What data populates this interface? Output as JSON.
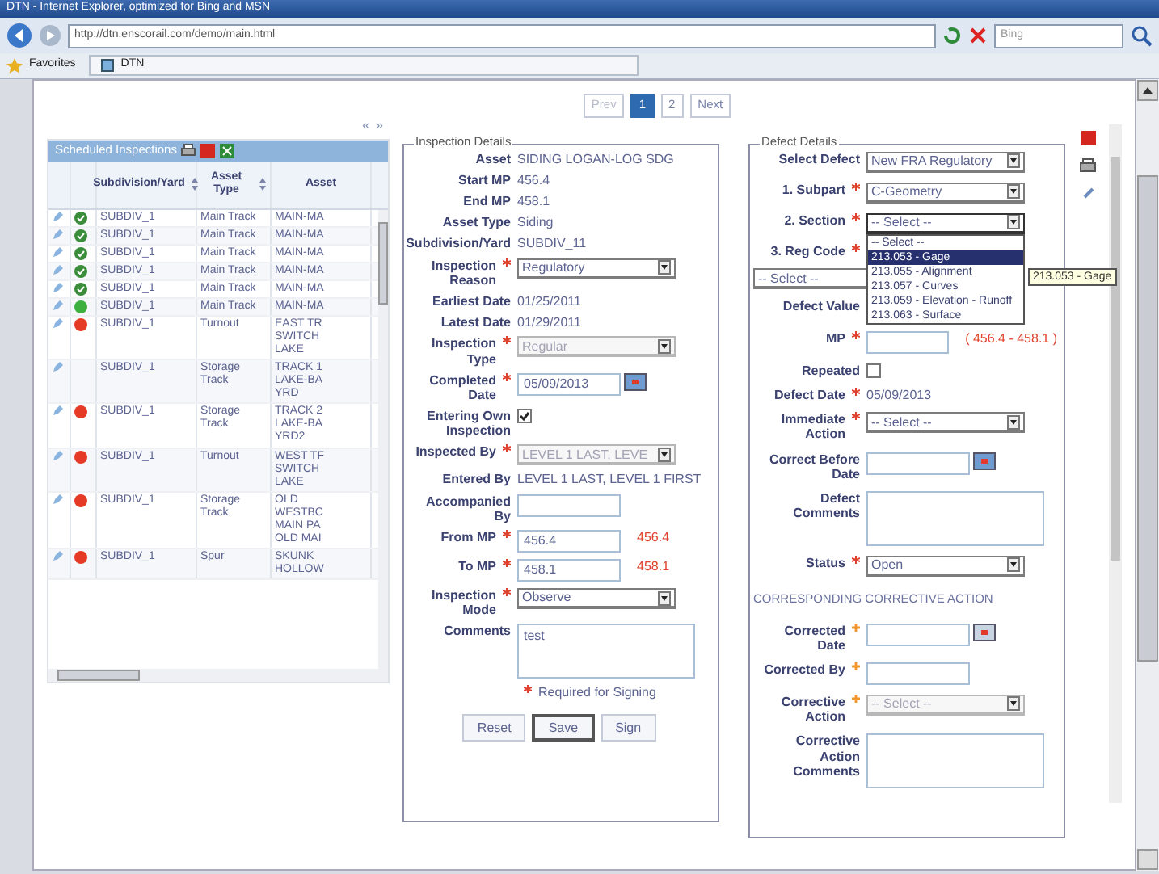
{
  "browser": {
    "title": "DTN - Internet Explorer, optimized for Bing and MSN",
    "address": "http://dtn.enscorail.com/demo/main.html",
    "search_placeholder": "Bing",
    "favorites": "Favorites",
    "tab": "DTN"
  },
  "pagination": [
    {
      "label": "Prev",
      "selected": false,
      "disabled": true
    },
    {
      "label": "1",
      "selected": true,
      "disabled": false
    },
    {
      "label": "2",
      "selected": false,
      "disabled": false
    },
    {
      "label": "Next",
      "selected": false,
      "disabled": false
    }
  ],
  "collapse": [
    "«",
    "»"
  ],
  "scheduled": {
    "title": "Scheduled Inspections",
    "columns": [
      {
        "label": "Subdivision/Yard",
        "sortable": true
      },
      {
        "label": "Asset Type",
        "sortable": true
      },
      {
        "label": "Asset",
        "sortable": false
      }
    ],
    "rows": [
      {
        "kind": "done",
        "subdivision": "SUBDIV_1",
        "asset_type": "Main Track",
        "asset": [
          "MAIN-MA"
        ]
      },
      {
        "kind": "done",
        "subdivision": "SUBDIV_1",
        "asset_type": "Main Track",
        "asset": [
          "MAIN-MA"
        ]
      },
      {
        "kind": "done",
        "subdivision": "SUBDIV_1",
        "asset_type": "Main Track",
        "asset": [
          "MAIN-MA"
        ]
      },
      {
        "kind": "done",
        "subdivision": "SUBDIV_1",
        "asset_type": "Main Track",
        "asset": [
          "MAIN-MA"
        ]
      },
      {
        "kind": "done",
        "subdivision": "SUBDIV_1",
        "asset_type": "Main Track",
        "asset": [
          "MAIN-MA"
        ]
      },
      {
        "kind": "ok",
        "subdivision": "SUBDIV_1",
        "asset_type": "Main Track",
        "asset": [
          "MAIN-MA"
        ]
      },
      {
        "kind": "overdue",
        "subdivision": "SUBDIV_1",
        "asset_type": "Turnout",
        "asset": [
          "EAST TR",
          "SWITCH",
          "LAKE"
        ]
      },
      {
        "subdivision": "SUBDIV_1",
        "asset_type": "Storage Track",
        "asset": [
          "TRACK 1",
          "LAKE-BA",
          "YRD"
        ]
      },
      {
        "kind": "overdue",
        "subdivision": "SUBDIV_1",
        "asset_type": "Storage Track",
        "asset": [
          "TRACK 2",
          "LAKE-BA",
          "YRD2"
        ]
      },
      {
        "kind": "overdue",
        "subdivision": "SUBDIV_1",
        "asset_type": "Turnout",
        "asset": [
          "WEST TF",
          "SWITCH",
          "LAKE"
        ]
      },
      {
        "kind": "overdue",
        "subdivision": "SUBDIV_1",
        "asset_type": "Storage Track",
        "asset": [
          "OLD",
          "WESTBC",
          "MAIN PA",
          "OLD MAI"
        ]
      },
      {
        "kind": "overdue",
        "subdivision": "SUBDIV_1",
        "asset_type": "Spur",
        "asset": [
          "SKUNK",
          "HOLLOW"
        ]
      }
    ]
  },
  "inspection": {
    "legend": "Inspection Details",
    "fields": [
      {
        "kind": "text",
        "label": "Asset",
        "value": "SIDING LOGAN-LOG SDG"
      },
      {
        "kind": "text",
        "label": "Start MP",
        "value": "456.4"
      },
      {
        "kind": "text",
        "label": "End MP",
        "value": "458.1"
      },
      {
        "kind": "text",
        "label": "Asset Type",
        "value": "Siding"
      },
      {
        "kind": "text",
        "label": "Subdivision/Yard",
        "value": "SUBDIV_11"
      },
      {
        "kind": "select",
        "label": "Inspection Reason",
        "required": true,
        "value": "Regulatory",
        "disabled": false
      },
      {
        "kind": "text",
        "label": "Earliest Date",
        "value": "01/25/2011"
      },
      {
        "kind": "text",
        "label": "Latest Date",
        "value": "01/29/2011"
      },
      {
        "kind": "select",
        "label": "Inspection Type",
        "required": true,
        "value": "Regular",
        "disabled": true
      },
      {
        "kind": "date",
        "label": "Completed Date",
        "required": true,
        "value": "05/09/2013",
        "disabled": false
      },
      {
        "kind": "checkbox",
        "label": "Entering Own Inspection",
        "checked": true
      },
      {
        "kind": "select",
        "label": "Inspected By",
        "required": true,
        "value": "LEVEL 1 LAST, LEVE",
        "disabled": true
      },
      {
        "kind": "text",
        "label": "Entered By",
        "value": "LEVEL 1 LAST, LEVEL 1 FIRST"
      },
      {
        "kind": "input",
        "label": "Accompanied By"
      },
      {
        "kind": "input",
        "label": "From MP",
        "required": true,
        "value": "456.4",
        "note": "456.4"
      },
      {
        "kind": "input",
        "label": "To MP",
        "required": true,
        "value": "458.1",
        "note": "458.1"
      },
      {
        "kind": "select",
        "label": "Inspection Mode",
        "required": true,
        "value": "Observe",
        "disabled": false
      },
      {
        "kind": "textarea",
        "label": "Comments",
        "value": "test"
      }
    ],
    "required_note": "Required for Signing",
    "buttons": [
      {
        "label": "Reset",
        "selected": false
      },
      {
        "label": "Save",
        "selected": true
      },
      {
        "label": "Sign",
        "selected": false
      }
    ]
  },
  "defect": {
    "legend": "Defect Details",
    "fields": [
      {
        "kind": "select",
        "label": "Select Defect",
        "value": "New FRA Regulatory",
        "disabled": false
      },
      {
        "kind": "select",
        "label": "1. Subpart",
        "required": true,
        "value": "C-Geometry",
        "disabled": false
      },
      {
        "kind": "select",
        "label": "2. Section",
        "required": true,
        "value": "-- Select --",
        "disabled": false,
        "open": true
      },
      {
        "kind": "label",
        "label": "3. Reg Code",
        "required": true
      },
      {
        "kind": "wideselect",
        "value": "-- Select --"
      },
      {
        "kind": "input",
        "label": "Defect Value"
      },
      {
        "kind": "input",
        "label": "MP",
        "required": true,
        "note": "( 456.4 - 458.1 )"
      },
      {
        "kind": "checkbox",
        "label": "Repeated",
        "checked": false
      },
      {
        "kind": "text",
        "label": "Defect Date",
        "required": true,
        "value": "05/09/2013"
      },
      {
        "kind": "select",
        "label": "Immediate Action",
        "required": true,
        "value": "-- Select --",
        "disabled": false
      },
      {
        "kind": "date",
        "label": "Correct Before Date",
        "disabled": false
      },
      {
        "kind": "textarea",
        "label": "Defect Comments"
      },
      {
        "kind": "select",
        "label": "Status",
        "required": true,
        "value": "Open",
        "disabled": false
      },
      {
        "kind": "heading",
        "label": "CORRESPONDING CORRECTIVE ACTION"
      },
      {
        "kind": "date",
        "label": "Corrected Date",
        "conditional": true,
        "disabled": true
      },
      {
        "kind": "input",
        "label": "Corrected By",
        "conditional": true
      },
      {
        "kind": "select",
        "label": "Corrective Action",
        "conditional": true,
        "value": "-- Select --",
        "disabled": true
      },
      {
        "kind": "textarea",
        "label": "Corrective Action Comments"
      }
    ],
    "dropdown": [
      {
        "label": "-- Select --",
        "selected": false
      },
      {
        "label": "213.053 - Gage",
        "selected": true
      },
      {
        "label": "213.055 - Alignment",
        "selected": false
      },
      {
        "label": "213.057 - Curves",
        "selected": false
      },
      {
        "label": "213.059 - Elevation - Runoff",
        "selected": false
      },
      {
        "label": "213.063 - Surface",
        "selected": false
      }
    ],
    "tooltip": "213.053 - Gage"
  }
}
